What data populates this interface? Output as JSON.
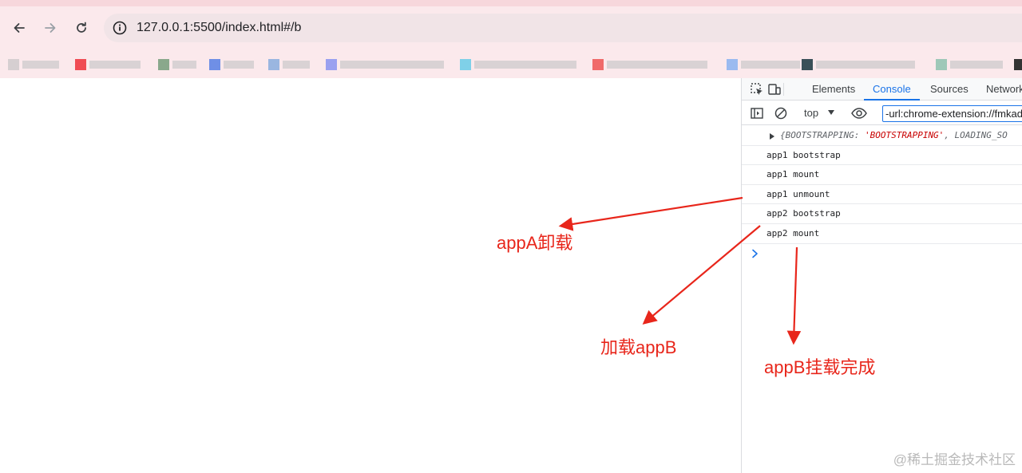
{
  "browser": {
    "url": "127.0.0.1:5500/index.html#/b",
    "icons": {
      "back": "back-arrow-icon",
      "forward": "forward-arrow-icon",
      "reload": "reload-icon",
      "site_info": "info-icon"
    },
    "bookmarks_note_colors": [
      "#f04c54",
      "#8aa88c",
      "#6f8fe6",
      "#9ab6e0",
      "#9aa0f0",
      "#7fd0e8",
      "#f06a6a",
      "#9abaf0",
      "#3a5058",
      "#9ec8b8"
    ]
  },
  "devtools": {
    "tabs": [
      "Elements",
      "Console",
      "Sources",
      "Network"
    ],
    "active_tab": "Console",
    "context": "top",
    "filter_value": "-url:chrome-extension://fmkad",
    "console_object": {
      "prefix": "{BOOTSTRAPPING: ",
      "value": "'BOOTSTRAPPING'",
      "suffix": ", LOADING_SO"
    },
    "logs": [
      "app1 bootstrap",
      "app1 mount",
      "app1 unmount",
      "app2 bootstrap",
      "app2 mount"
    ],
    "prompt": ">"
  },
  "annotations": {
    "unmount_a": "appA卸载",
    "load_b": "加载appB",
    "mount_b": "appB挂载完成",
    "color": "#e8261b"
  },
  "watermark": "@稀土掘金技术社区"
}
